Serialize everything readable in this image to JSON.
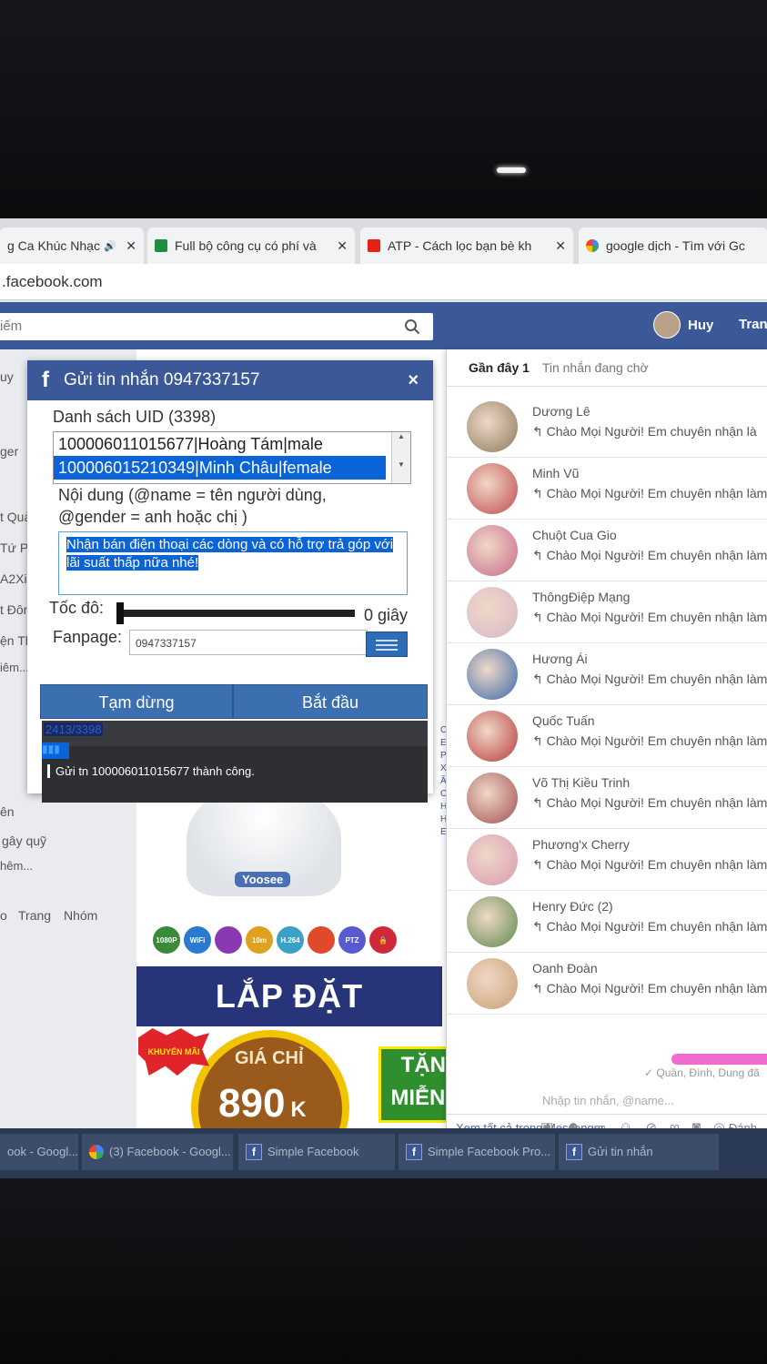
{
  "browser": {
    "tabs": [
      {
        "title": "g Ca Khúc Nhạc",
        "audio_icon": "🔊",
        "close": "✕"
      },
      {
        "title": "Full bộ công cụ có phí và",
        "close": "✕"
      },
      {
        "title": "ATP - Cách lọc bạn bè kh",
        "close": "✕"
      },
      {
        "title": "google dịch - Tìm với Gc"
      }
    ],
    "url": ".facebook.com"
  },
  "facebook": {
    "search_placeholder": "iếm",
    "user_name": "Huy",
    "nav_right": "Tran",
    "left_texts": [
      "uy",
      "ger",
      "t Quản",
      "Tứ Ph",
      "A2Xir",
      "t Đông",
      "ện Thọ",
      "iêm...",
      "ên",
      "gây quỹ",
      "hêm...",
      "o",
      "Trang",
      "Nhóm"
    ]
  },
  "dialog": {
    "title": "Gửi tin nhắn 0947337157",
    "close": "×",
    "uid_label": "Danh sách UID (3398)",
    "uids": [
      "100006011015677|Hoàng Tám|male",
      "100006015210349|Minh Châu|female"
    ],
    "content_label_1": "Nội dung (@name = tên người dùng,",
    "content_label_2": "@gender = anh hoặc chị )",
    "content_text": "Nhận bán điện thoại các dòng và có hỗ trợ trả góp với lãi suất thấp nữa nhé!",
    "speed_label": "Tốc đô:",
    "speed_value": "0 giây",
    "speed_level": 0,
    "fanpage_label": "Fanpage:",
    "fanpage_value": "0947337157",
    "pause_button": "Tạm dừng",
    "start_button": "Bắt đầu",
    "progress_text": "2413/3398",
    "log_line": "Gửi tn 100006011015677 thành công."
  },
  "messenger": {
    "tab_recent": "Gần đây 1",
    "tab_pending": "Tin nhắn đang chờ",
    "conversations": [
      {
        "name": "Dương Lê",
        "preview": "↰ Chào Mọi Người! Em chuyên nhận là",
        "color": "#8a7a5a"
      },
      {
        "name": "Minh Vũ",
        "preview": "↰ Chào Mọi Người! Em chuyên nhận làm",
        "color": "#c04a4a"
      },
      {
        "name": "Chuột Cua Gio",
        "preview": "↰ Chào Mọi Người! Em chuyên nhận làm",
        "color": "#c86a8a"
      },
      {
        "name": "ThôngĐiệp Mạng",
        "preview": "↰ Chào Mọi Người! Em chuyên nhận làm",
        "color": "#d7b8c8"
      },
      {
        "name": "Hương Ái",
        "preview": "↰ Chào Mọi Người! Em chuyên nhận làm",
        "color": "#3a6aa8"
      },
      {
        "name": "Quốc Tuấn",
        "preview": "↰ Chào Mọi Người! Em chuyên nhận làm c",
        "color": "#b83a3a"
      },
      {
        "name": "Võ Thị Kiều Trinh",
        "preview": "↰ Chào Mọi Người! Em chuyên nhận làm c",
        "color": "#a05050"
      },
      {
        "name": "Phương'x Cherry",
        "preview": "↰ Chào Mọi Người! Em chuyên nhận làm cá",
        "color": "#d89ab0"
      },
      {
        "name": "Henry Đức (2)",
        "preview": "↰ Chào Mọi Người! Em chuyên nhận làm cá",
        "color": "#5a8a4a"
      },
      {
        "name": "Oanh Đoàn",
        "preview": "↰ Chào Mọi Người! Em chuyên nhận làm các",
        "color": "#c8a070"
      }
    ],
    "see_all": "Xem tất cả trong Messenger",
    "mark": "Đánh"
  },
  "chat": {
    "input_placeholder": "Nhập tin nhắn, @name...",
    "status": "✓ Quần, Đình, Dung đã"
  },
  "ad": {
    "brand": "Yoosee",
    "badges": [
      "1080P",
      "WiFi",
      "",
      "10m",
      "H.264",
      "",
      "PTZ",
      "🔒"
    ],
    "banner": "LẮP ĐẶT CAMERA",
    "burst": "KHUYẾN MÃI",
    "price_label": "GIÁ CHỈ",
    "price": "890",
    "price_unit": "K",
    "gift_1": "TẶNG THẺ",
    "gift_2": "MIỄN PHÍ LẮ"
  },
  "taskbar": [
    {
      "label": "ook - Googl..."
    },
    {
      "label": "(3) Facebook - Googl..."
    },
    {
      "label": "Simple Facebook"
    },
    {
      "label": "Simple Facebook Pro..."
    },
    {
      "label": "Gửi tin nhắn"
    }
  ]
}
